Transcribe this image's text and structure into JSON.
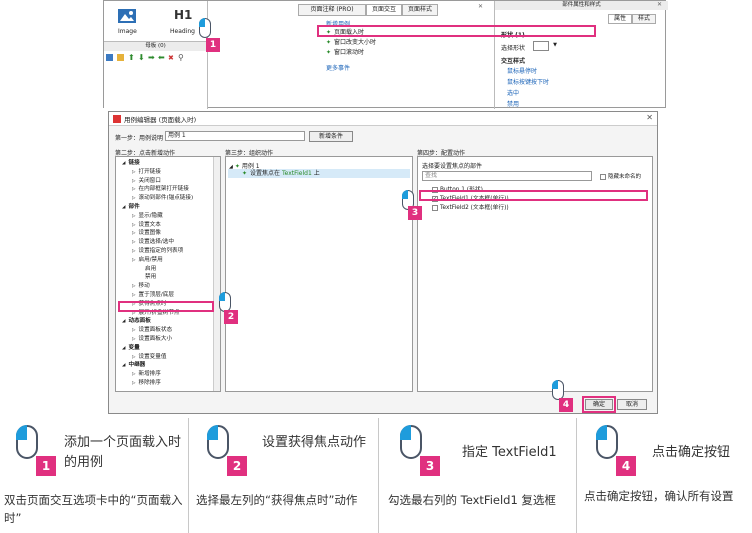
{
  "top": {
    "widgets": {
      "image_label": "Image",
      "heading_label": "Heading",
      "h1_text": "H1"
    },
    "master_title": "母板 (0)",
    "tabs": [
      "页面注释 (PRO)",
      "页面交互",
      "页面样式"
    ],
    "new_case": "新增用例",
    "events": [
      "页面载入时",
      "窗口改变大小时",
      "窗口滚动时"
    ],
    "more_events": "更多事件",
    "props_header": "部件属性和样式",
    "props_tabs": [
      "属性",
      "样式"
    ],
    "props_items": {
      "shape": "形状 (1)",
      "select_shape": "选择形状",
      "interaction": "交互样式",
      "hover": "鼠标悬停时",
      "mouse_down": "鼠标按键按下时",
      "selected": "选中",
      "disabled": "禁用"
    }
  },
  "dialog": {
    "title": "用例编辑器 (页面载入时)",
    "step1_label": "第一步：用例说明",
    "case_name": "用例 1",
    "add_condition": "新增条件",
    "step2_label": "第二步：点击新增动作",
    "step3_label": "第三步：组织动作",
    "step4_label": "第四步：配置动作",
    "actions": [
      {
        "t": "链接",
        "b": true,
        "i": 0
      },
      {
        "t": "打开链接",
        "b": false,
        "i": 1
      },
      {
        "t": "关闭窗口",
        "b": false,
        "i": 1
      },
      {
        "t": "在内部框架打开链接",
        "b": false,
        "i": 1
      },
      {
        "t": "滚动到部件(锚点链接)",
        "b": false,
        "i": 1
      },
      {
        "t": "部件",
        "b": true,
        "i": 0
      },
      {
        "t": "显示/隐藏",
        "b": false,
        "i": 1
      },
      {
        "t": "设置文本",
        "b": false,
        "i": 1
      },
      {
        "t": "设置图像",
        "b": false,
        "i": 1
      },
      {
        "t": "设置选择/选中",
        "b": false,
        "i": 1
      },
      {
        "t": "设置指定的列表项",
        "b": false,
        "i": 1
      },
      {
        "t": "启用/禁用",
        "b": false,
        "i": 1
      },
      {
        "t": "启用",
        "b": false,
        "i": 2
      },
      {
        "t": "禁用",
        "b": false,
        "i": 2
      },
      {
        "t": "移动",
        "b": false,
        "i": 1
      },
      {
        "t": "置于顶层/底层",
        "b": false,
        "i": 1
      },
      {
        "t": "获得焦点时",
        "b": false,
        "i": 1
      },
      {
        "t": "展开/折叠树节点",
        "b": false,
        "i": 1
      },
      {
        "t": "动态面板",
        "b": true,
        "i": 0
      },
      {
        "t": "设置面板状态",
        "b": false,
        "i": 1
      },
      {
        "t": "设置面板大小",
        "b": false,
        "i": 1
      },
      {
        "t": "变量",
        "b": true,
        "i": 0
      },
      {
        "t": "设置变量值",
        "b": false,
        "i": 1
      },
      {
        "t": "中继器",
        "b": true,
        "i": 0
      },
      {
        "t": "新增排序",
        "b": false,
        "i": 1
      },
      {
        "t": "移除排序",
        "b": false,
        "i": 1
      }
    ],
    "organize_case": "用例 1",
    "organize_action_prefix": "设置焦点在",
    "organize_action_target": "TextField1",
    "organize_action_suffix": "上",
    "config_label": "选择要设置焦点的部件",
    "search_placeholder": "查找",
    "hide_unnamed": "隐藏未命名的",
    "widgets_list": [
      {
        "name": "Button 1 (形状)",
        "checked": false
      },
      {
        "name": "TextField1 (文本框(单行))",
        "checked": true
      },
      {
        "name": "TextField2 (文本框(单行))",
        "checked": false
      }
    ],
    "ok": "确定",
    "cancel": "取消"
  },
  "steps": [
    {
      "num": "1",
      "title": "添加一个页面载入时的用例",
      "desc": "双击页面交互选项卡中的“页面载入时”"
    },
    {
      "num": "2",
      "title": "设置获得焦点动作",
      "desc": "选择最左列的“获得焦点时”动作"
    },
    {
      "num": "3",
      "title": "指定 TextField1",
      "desc": "勾选最右列的 TextField1 复选框"
    },
    {
      "num": "4",
      "title": "点击确定按钮",
      "desc": "点击确定按钮，确认所有设置"
    }
  ],
  "colors": {
    "accent": "#e0307f",
    "mouse_blue": "#1e9cdc"
  }
}
